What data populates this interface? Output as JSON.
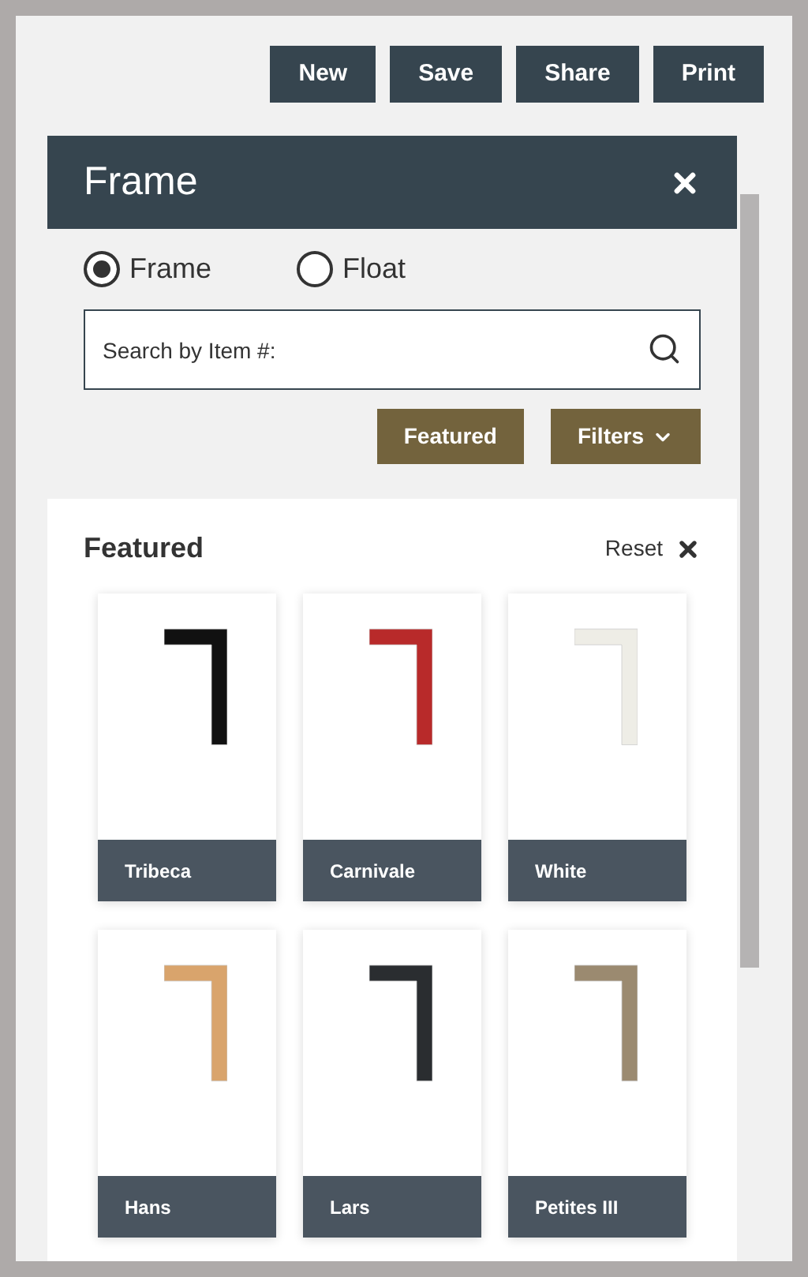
{
  "toolbar": {
    "buttons": [
      "New",
      "Save",
      "Share",
      "Print"
    ]
  },
  "panel": {
    "title": "Frame",
    "modes": [
      {
        "label": "Frame",
        "selected": true
      },
      {
        "label": "Float",
        "selected": false
      }
    ],
    "search": {
      "placeholder": "Search by Item #:"
    },
    "actions": [
      {
        "label": "Featured",
        "kind": "plain"
      },
      {
        "label": "Filters",
        "kind": "dropdown"
      }
    ],
    "section_title": "Featured",
    "reset": "Reset",
    "frames": [
      {
        "name": "Tribeca",
        "color": "#111111"
      },
      {
        "name": "Carnivale",
        "color": "#b82a2a"
      },
      {
        "name": "White",
        "color": "#eeede6"
      },
      {
        "name": "Hans",
        "color": "#d9a46c"
      },
      {
        "name": "Lars",
        "color": "#2a2d30"
      },
      {
        "name": "Petites III",
        "color": "#9b8a70"
      }
    ]
  }
}
